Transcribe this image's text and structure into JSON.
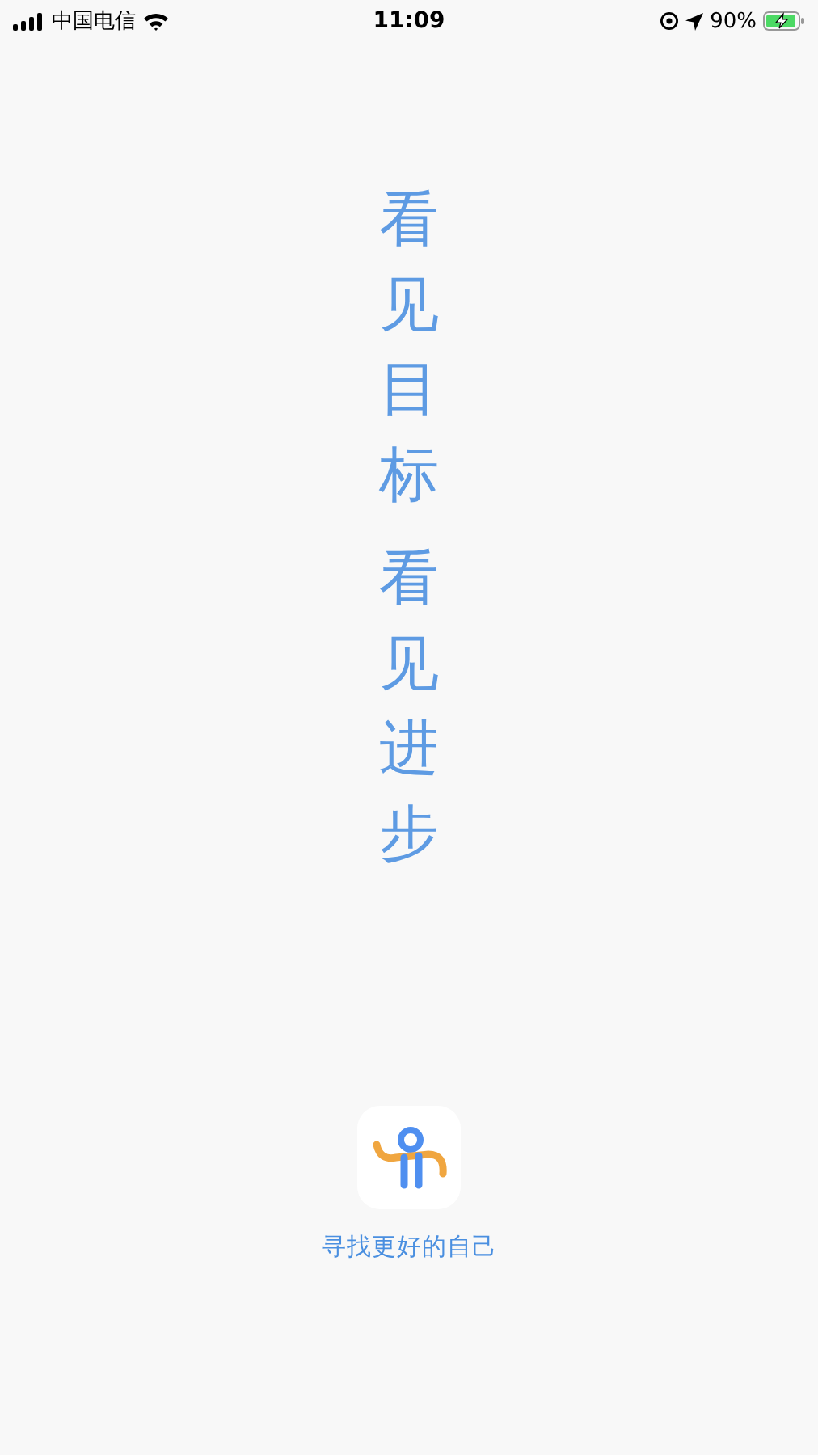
{
  "status_bar": {
    "carrier": "中国电信",
    "time": "11:09",
    "battery": "90%"
  },
  "slogans": [
    "看见目标",
    "看见进步"
  ],
  "tagline": "寻找更好的自己"
}
